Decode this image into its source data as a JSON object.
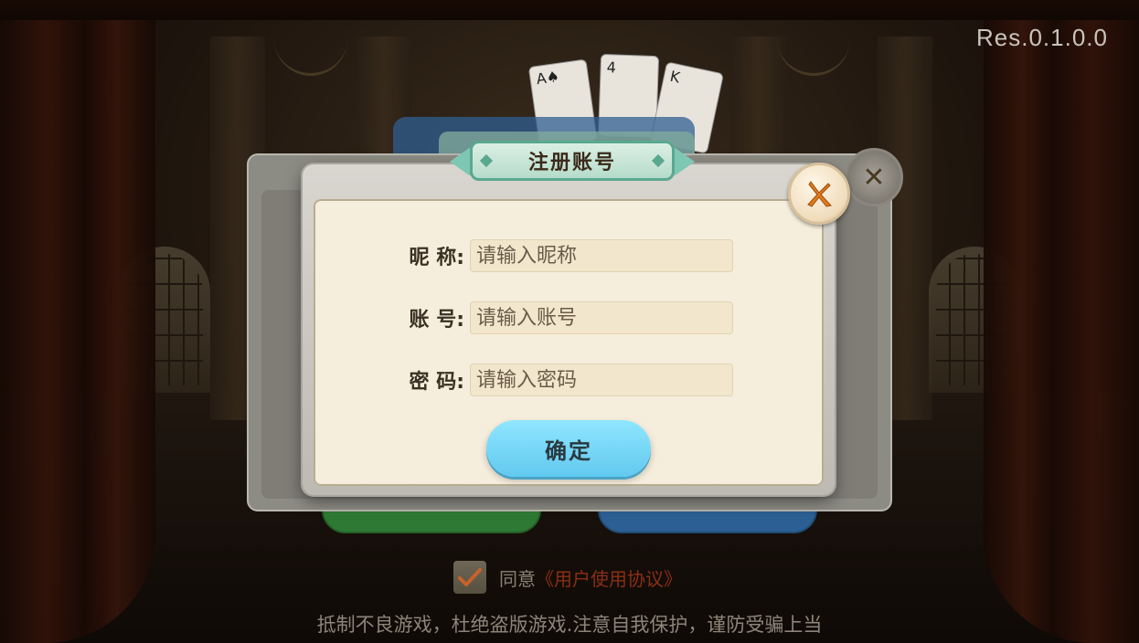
{
  "version": "Res.0.1.0.0",
  "dialog": {
    "title": "注册账号",
    "fields": {
      "nickname": {
        "label": "昵 称:",
        "placeholder": "请输入昵称"
      },
      "account": {
        "label": "账 号:",
        "placeholder": "请输入账号"
      },
      "password": {
        "label": "密 码:",
        "placeholder": "请输入密码"
      }
    },
    "confirm_label": "确定",
    "close_icon": "close-x-icon"
  },
  "background": {
    "cards": [
      "A♠",
      "4",
      "♠",
      "K"
    ]
  },
  "agreement": {
    "prefix": "同意",
    "link": "《用户使用协议》",
    "checked": true
  },
  "notice": "抵制不良游戏，杜绝盗版游戏.注意自我保护，谨防受骗上当",
  "colors": {
    "confirm": "#62c9ef",
    "title_banner": "#7ec7b2",
    "link": "#8b2e14",
    "close_icon": "#e07a1a"
  }
}
